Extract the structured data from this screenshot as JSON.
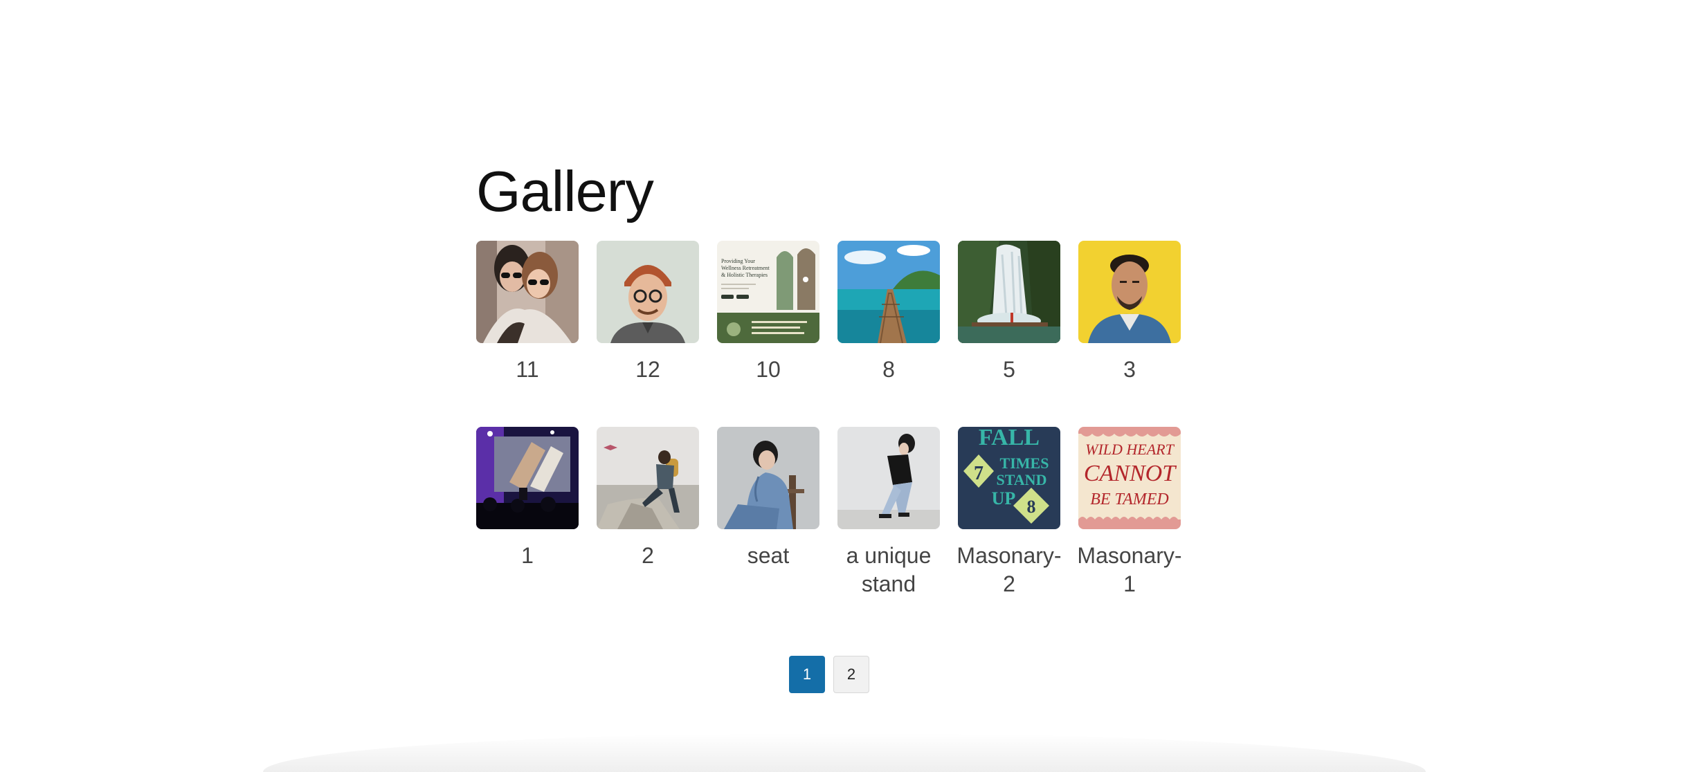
{
  "gallery": {
    "title": "Gallery",
    "items": [
      {
        "caption": "11",
        "image": "two-women-sunglasses-photo"
      },
      {
        "caption": "12",
        "image": "man-glasses-beanie-photo"
      },
      {
        "caption": "10",
        "image": "wellness-website-mockup"
      },
      {
        "caption": "8",
        "image": "wooden-pier-lagoon-photo"
      },
      {
        "caption": "5",
        "image": "waterfall-forest-photo"
      },
      {
        "caption": "3",
        "image": "man-yellow-background-photo"
      },
      {
        "caption": "1",
        "image": "stage-presentation-phone-photo"
      },
      {
        "caption": "2",
        "image": "hiker-on-rock-photo"
      },
      {
        "caption": "seat",
        "image": "woman-denim-on-chair-photo"
      },
      {
        "caption": "a unique stand",
        "image": "woman-leaning-pose-photo"
      },
      {
        "caption": "Masonary-2",
        "image": "fall-7-times-typography-poster"
      },
      {
        "caption": "Masonary-1",
        "image": "wild-heart-typography-poster"
      }
    ],
    "thumbnail_text": {
      "wellness_headline": "Providing Your Wellness Retreatment & Holistic Therapies",
      "poster_fall": [
        "FALL",
        "7",
        "TIMES",
        "STAND",
        "UP",
        "8"
      ],
      "poster_wild": [
        "WILD HEART",
        "CANNOT",
        "BE TAMED"
      ]
    }
  },
  "pagination": {
    "pages": [
      "1",
      "2"
    ],
    "current": "1",
    "active_color": "#146ea8"
  }
}
